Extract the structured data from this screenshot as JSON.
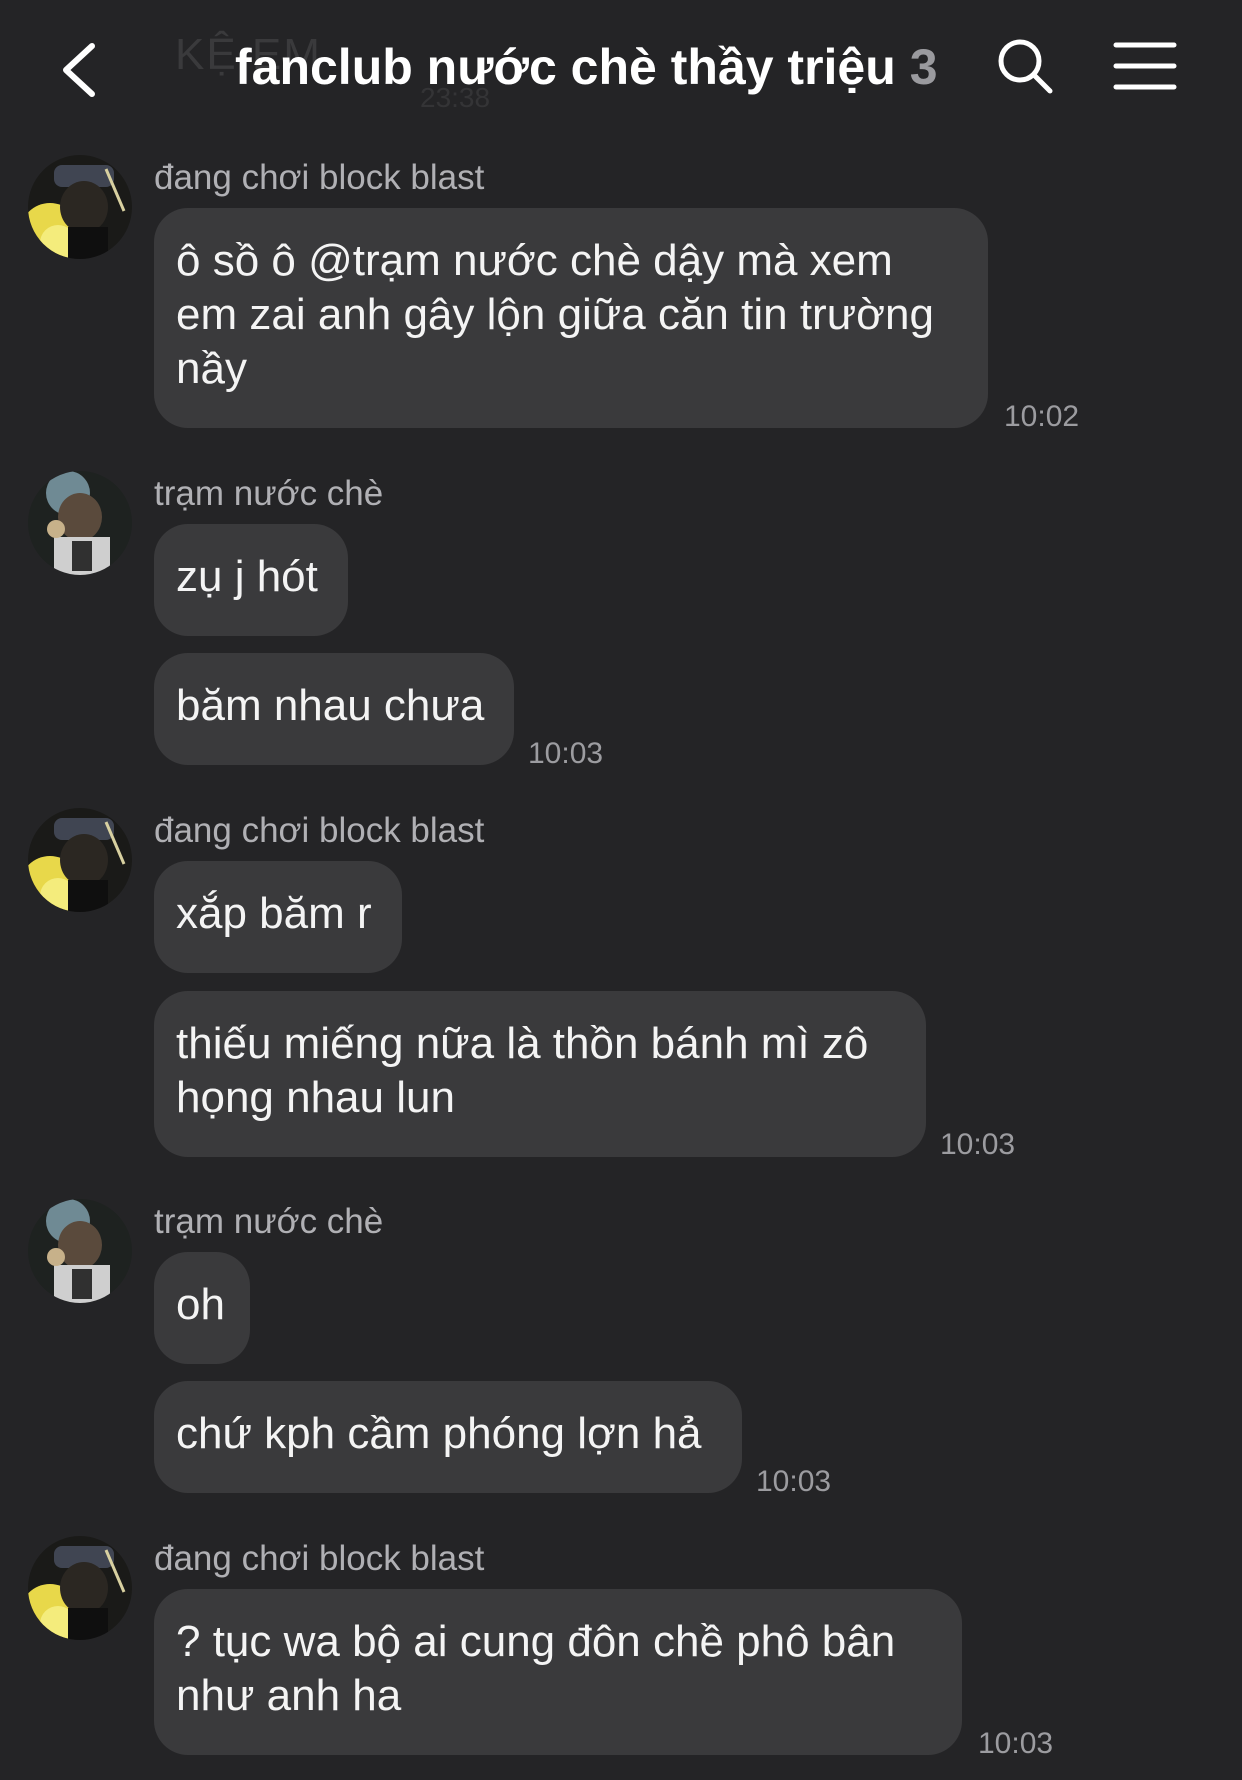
{
  "header": {
    "ghost_text": "KỆ EM",
    "ghost_time": "23:38",
    "title": "fanclub nước chè thầy triệu",
    "member_count": "3"
  },
  "messages": [
    {
      "sender": "đang chơi block blast",
      "text": "ô sồ ô @trạm nước chè dậy mà xem em zai anh gây lộn giữa căn tin trường nầy",
      "time": "10:02"
    },
    {
      "sender": "trạm nước chè",
      "text": "zụ j hót",
      "time": ""
    },
    {
      "sender": "",
      "text": "băm nhau chưa",
      "time": "10:03"
    },
    {
      "sender": "đang chơi block blast",
      "text": "xắp băm r",
      "time": ""
    },
    {
      "sender": "",
      "text": "thiếu miếng nữa là thồn bánh mì zô họng nhau lun",
      "time": "10:03"
    },
    {
      "sender": "trạm nước chè",
      "text": "oh",
      "time": ""
    },
    {
      "sender": "",
      "text": "chứ kph cầm phóng lợn hả",
      "time": "10:03"
    },
    {
      "sender": "đang chơi block blast",
      "text": "? tục wa bộ ai cung đôn chề phô bân như anh ha",
      "time": "10:03"
    }
  ],
  "colors": {
    "background": "#242426",
    "bubble": "#3a3a3c",
    "title": "#ffffff",
    "secondary_text": "#b0b0b4"
  },
  "icons": [
    "back-chevron-icon",
    "search-icon",
    "hamburger-menu-icon"
  ]
}
